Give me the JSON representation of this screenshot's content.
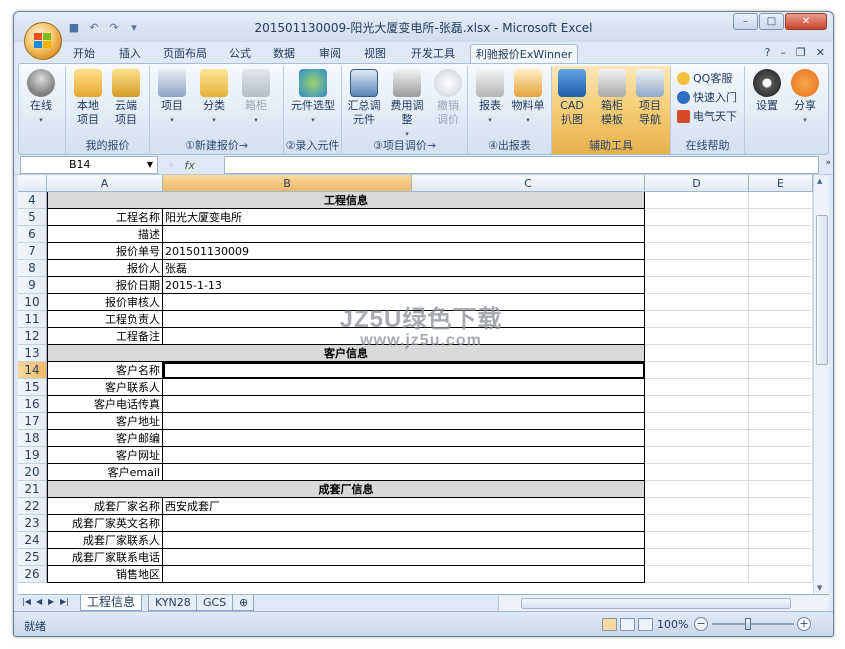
{
  "window": {
    "title": "201501130009-阳光大厦变电所-张磊.xlsx - Microsoft Excel",
    "min": "–",
    "max": "□",
    "close": "✕"
  },
  "tabs": [
    "开始",
    "插入",
    "页面布局",
    "公式",
    "数据",
    "审阅",
    "视图",
    "开发工具",
    "利驰报价ExWinner"
  ],
  "ribbon": {
    "groups": [
      "我的报价",
      "①新建报价→",
      "②录入元件",
      "③项目调价→",
      "④出报表",
      "辅助工具",
      "在线帮助"
    ],
    "buttons": {
      "online": "在线",
      "local": "本地\n项目",
      "cloud": "云端\n项目",
      "project": "项目",
      "classify": "分类",
      "cabinet": "箱柜",
      "component": "元件选型",
      "summary": "汇总调\n元件",
      "fee": "费用调整",
      "undo": "撤销\n调价",
      "report": "报表",
      "bom": "物料单",
      "cad": "CAD\n扒图",
      "boxtpl": "箱柜\n模板",
      "nav": "项目\n导航",
      "qq": "QQ客服",
      "quick": "快速入门",
      "elec": "电气天下",
      "settings": "设置",
      "share": "分享"
    }
  },
  "formula_bar": {
    "name_box": "B14",
    "fx": "fx",
    "value": ""
  },
  "columns": [
    "A",
    "B",
    "C",
    "D",
    "E"
  ],
  "rows": [
    {
      "n": "4",
      "type": "header",
      "text": "工程信息"
    },
    {
      "n": "5",
      "label": "工程名称",
      "value": "阳光大厦变电所"
    },
    {
      "n": "6",
      "label": "描述",
      "value": ""
    },
    {
      "n": "7",
      "label": "报价单号",
      "value": "201501130009"
    },
    {
      "n": "8",
      "label": "报价人",
      "value": "张磊"
    },
    {
      "n": "9",
      "label": "报价日期",
      "value": "2015-1-13"
    },
    {
      "n": "10",
      "label": "报价审核人",
      "value": ""
    },
    {
      "n": "11",
      "label": "工程负责人",
      "value": ""
    },
    {
      "n": "12",
      "label": "工程备注",
      "value": ""
    },
    {
      "n": "13",
      "type": "header",
      "text": "客户信息"
    },
    {
      "n": "14",
      "label": "客户名称",
      "value": ""
    },
    {
      "n": "15",
      "label": "客户联系人",
      "value": ""
    },
    {
      "n": "16",
      "label": "客户电话传真",
      "value": ""
    },
    {
      "n": "17",
      "label": "客户地址",
      "value": ""
    },
    {
      "n": "18",
      "label": "客户邮编",
      "value": ""
    },
    {
      "n": "19",
      "label": "客户网址",
      "value": ""
    },
    {
      "n": "20",
      "label": "客户email",
      "value": ""
    },
    {
      "n": "21",
      "type": "header",
      "text": "成套厂信息"
    },
    {
      "n": "22",
      "label": "成套厂家名称",
      "value": "西安成套厂"
    },
    {
      "n": "23",
      "label": "成套厂家英文名称",
      "value": ""
    },
    {
      "n": "24",
      "label": "成套厂家联系人",
      "value": ""
    },
    {
      "n": "25",
      "label": "成套厂家联系电话",
      "value": ""
    },
    {
      "n": "26",
      "label": "销售地区",
      "value": ""
    }
  ],
  "sheets": [
    "工程信息",
    "KYN28",
    "GCS"
  ],
  "status": {
    "text": "就绪",
    "zoom": "100%"
  },
  "watermark": {
    "line1": "JZ5U绿色下载",
    "line2": "www.jz5u.com"
  }
}
